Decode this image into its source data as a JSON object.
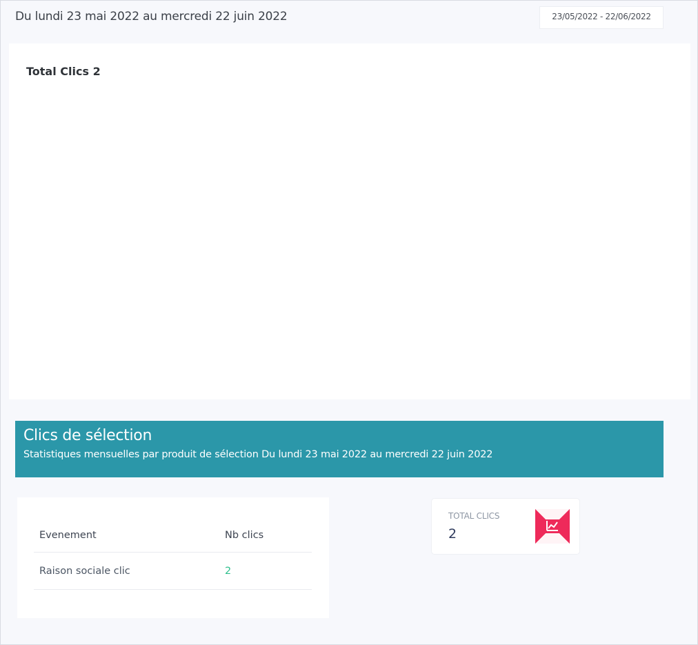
{
  "header": {
    "period_text": "Du lundi 23 mai 2022 au mercredi 22 juin 2022",
    "date_range_value": "23/05/2022 - 22/06/2022"
  },
  "chart_card": {
    "title": "Total Clics 2"
  },
  "section": {
    "title": "Clics de sélection",
    "subtitle": "Statistiques mensuelles par produit de sélection Du lundi 23 mai 2022 au mercredi 22 juin 2022",
    "banner_color": "#2b97a9"
  },
  "table": {
    "headers": [
      "Evenement",
      "Nb clics"
    ],
    "rows": [
      {
        "event": "Raison sociale clic",
        "clicks": "2"
      }
    ]
  },
  "stat_card": {
    "label": "TOTAL CLICS",
    "value": "2",
    "icon": "chart-line-icon",
    "icon_color": "#ee2a5a"
  }
}
